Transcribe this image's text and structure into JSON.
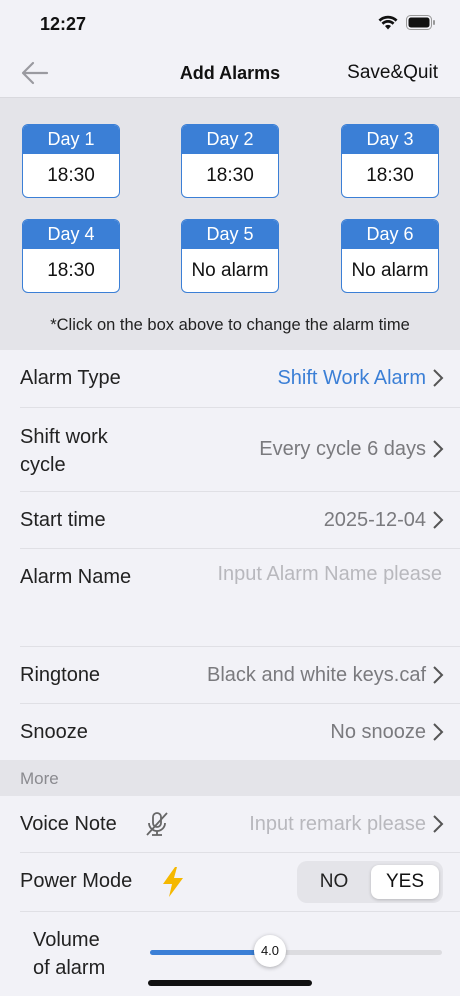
{
  "status": {
    "time": "12:27"
  },
  "nav": {
    "title": "Add Alarms",
    "save_label": "Save&Quit"
  },
  "days": [
    {
      "label": "Day 1",
      "time": "18:30"
    },
    {
      "label": "Day 2",
      "time": "18:30"
    },
    {
      "label": "Day 3",
      "time": "18:30"
    },
    {
      "label": "Day 4",
      "time": "18:30"
    },
    {
      "label": "Day 5",
      "time": "No alarm"
    },
    {
      "label": "Day 6",
      "time": "No alarm"
    }
  ],
  "days_note": "*Click on the box above to change the alarm time",
  "form": {
    "alarm_type": {
      "label": "Alarm Type",
      "value": "Shift Work Alarm"
    },
    "shift_cycle": {
      "label_line1": "Shift work",
      "label_line2": "cycle",
      "value": "Every cycle 6 days"
    },
    "start_time": {
      "label": "Start time",
      "value": "2025-12-04"
    },
    "alarm_name": {
      "label": "Alarm Name",
      "placeholder": "Input Alarm Name please"
    },
    "ringtone": {
      "label": "Ringtone",
      "value": "Black and white keys.caf"
    },
    "snooze": {
      "label": "Snooze",
      "value": "No snooze"
    }
  },
  "more": {
    "header": "More",
    "voice_note": {
      "label": "Voice Note",
      "placeholder": "Input remark please",
      "icon": "microphone-off-icon"
    },
    "power_mode": {
      "label": "Power Mode",
      "icon": "lightning-icon",
      "options": [
        "NO",
        "YES"
      ],
      "selected": "YES"
    },
    "volume": {
      "label_line1": "Volume",
      "label_line2": "of alarm",
      "value": "4.0",
      "fraction": 0.41
    }
  },
  "colors": {
    "accent": "#3b7fd6",
    "bolt": "#f5b800",
    "background": "#f2f2f7",
    "section": "#e4e4e9"
  }
}
